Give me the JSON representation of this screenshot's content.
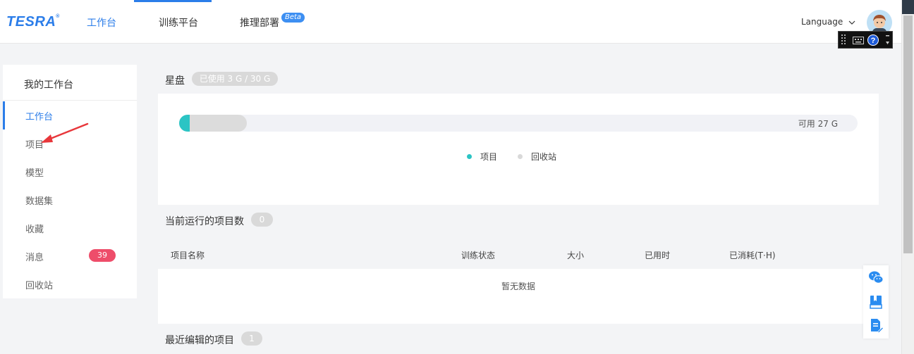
{
  "brand": {
    "logo_text": "TESRA",
    "logo_mark": "®",
    "accent_color": "#2b7de9"
  },
  "topnav": {
    "items": [
      {
        "label": "工作台",
        "active": true
      },
      {
        "label": "训练平台",
        "active": false
      },
      {
        "label": "推理部署",
        "active": false,
        "badge": "Beta"
      }
    ],
    "language_label": "Language"
  },
  "sidebar": {
    "title": "我的工作台",
    "items": [
      {
        "label": "工作台",
        "active": true
      },
      {
        "label": "项目"
      },
      {
        "label": "模型"
      },
      {
        "label": "数据集"
      },
      {
        "label": "收藏"
      },
      {
        "label": "消息",
        "badge": "39"
      },
      {
        "label": "回收站"
      }
    ]
  },
  "storage": {
    "title": "星盘",
    "usage_pill": "已使用 3 G / 30 G",
    "available_label": "可用 27 G",
    "project_fraction": 0.016,
    "recycle_fraction": 0.084,
    "project_color": "#2bc4c4",
    "recycle_color": "#dcdcdc",
    "legend": {
      "project": "项目",
      "recycle": "回收站"
    }
  },
  "running": {
    "title": "当前运行的项目数",
    "count": "0",
    "columns": [
      "项目名称",
      "训练状态",
      "大小",
      "已用时",
      "已消耗(T·H)"
    ],
    "empty_text": "暂无数据"
  },
  "recent": {
    "title": "最近编辑的项目",
    "count": "1"
  }
}
